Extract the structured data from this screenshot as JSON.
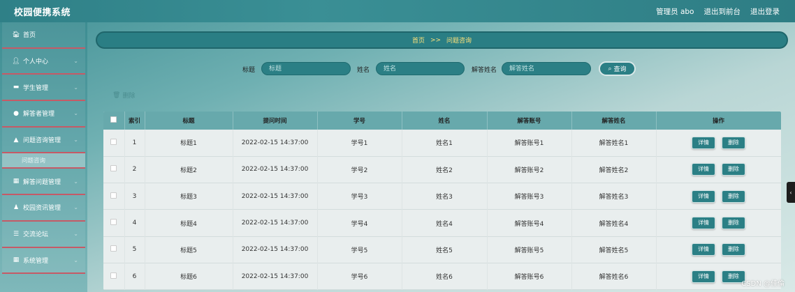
{
  "header": {
    "title": "校园便携系统",
    "admin_label": "管理员 abo",
    "exit_front": "退出到前台",
    "logout": "退出登录"
  },
  "sidebar": {
    "items": [
      {
        "label": "首页",
        "icon": "home-icon",
        "glyph": "🏠︎"
      },
      {
        "label": "个人中心",
        "icon": "user-icon",
        "glyph": "👤︎"
      },
      {
        "label": "学生管理",
        "icon": "card-icon",
        "glyph": "▬"
      },
      {
        "label": "解答者管理",
        "icon": "location-icon",
        "glyph": "●"
      },
      {
        "label": "问题咨询管理",
        "icon": "bank-icon",
        "glyph": "▲"
      },
      {
        "label": "解答问题管理",
        "icon": "grid-icon",
        "glyph": "▦"
      },
      {
        "label": "校园资讯管理",
        "icon": "person-icon",
        "glyph": "♟"
      },
      {
        "label": "交流论坛",
        "icon": "sliders-icon",
        "glyph": "☰"
      },
      {
        "label": "系统管理",
        "icon": "grid-icon",
        "glyph": "▦"
      }
    ],
    "submenu": {
      "label": "问题咨询"
    }
  },
  "breadcrumb": {
    "home": "首页",
    "sep": ">>",
    "current": "问题咨询"
  },
  "search": {
    "title_label": "标题",
    "title_placeholder": "标题",
    "name_label": "姓名",
    "name_placeholder": "姓名",
    "answer_label": "解答姓名",
    "answer_placeholder": "解答姓名",
    "query_button": "查询"
  },
  "actions": {
    "delete": "删除"
  },
  "table": {
    "columns": [
      "索引",
      "标题",
      "提问时间",
      "学号",
      "姓名",
      "解答账号",
      "解答姓名",
      "操作"
    ],
    "detail_label": "详情",
    "delete_label": "删除",
    "rows": [
      {
        "index": "1",
        "title": "标题1",
        "time": "2022-02-15 14:37:00",
        "sid": "学号1",
        "name": "姓名1",
        "aacc": "解答账号1",
        "aname": "解答姓名1"
      },
      {
        "index": "2",
        "title": "标题2",
        "time": "2022-02-15 14:37:00",
        "sid": "学号2",
        "name": "姓名2",
        "aacc": "解答账号2",
        "aname": "解答姓名2"
      },
      {
        "index": "3",
        "title": "标题3",
        "time": "2022-02-15 14:37:00",
        "sid": "学号3",
        "name": "姓名3",
        "aacc": "解答账号3",
        "aname": "解答姓名3"
      },
      {
        "index": "4",
        "title": "标题4",
        "time": "2022-02-15 14:37:00",
        "sid": "学号4",
        "name": "姓名4",
        "aacc": "解答账号4",
        "aname": "解答姓名4"
      },
      {
        "index": "5",
        "title": "标题5",
        "time": "2022-02-15 14:37:00",
        "sid": "学号5",
        "name": "姓名5",
        "aacc": "解答账号5",
        "aname": "解答姓名5"
      },
      {
        "index": "6",
        "title": "标题6",
        "time": "2022-02-15 14:37:00",
        "sid": "学号6",
        "name": "姓名6",
        "aacc": "解答账号6",
        "aname": "解答姓名6"
      }
    ]
  },
  "watermark": "CSDN @佳倫"
}
